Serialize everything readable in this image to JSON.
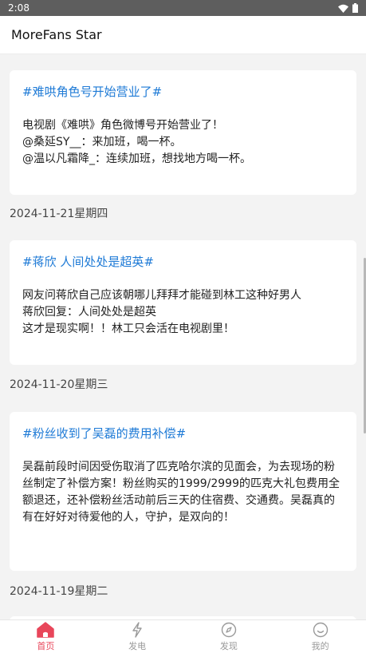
{
  "status_bar": {
    "time": "2:08",
    "icons": [
      "wifi-icon",
      "battery-icon"
    ]
  },
  "app_bar": {
    "title": "MoreFans Star"
  },
  "posts": [
    {
      "title": "#难哄角色号开始营业了#",
      "body": "电视剧《难哄》角色微博号开始营业了！\n@桑延SY__：来加班，喝一杯。\n@温以凡霜降_：连续加班，想找地方喝一杯。",
      "date": "2024-11-21星期四"
    },
    {
      "title": "#蒋欣 人间处处是超英#",
      "body": "网友问蒋欣自己应该朝哪儿拜拜才能碰到林工这种好男人\n蒋欣回复：人间处处是超英\n这才是现实啊！！林工只会活在电视剧里！",
      "date": "2024-11-20星期三"
    },
    {
      "title": "#粉丝收到了吴磊的费用补偿#",
      "body": "吴磊前段时间因受伤取消了匹克哈尔滨的见面会，为去现场的粉丝制定了补偿方案！粉丝购买的1999/2999的匹克大礼包费用全额退还，还补偿粉丝活动前后三天的住宿费、交通费。吴磊真的有在好好对待爱他的人，守护，是双向的！",
      "date": "2024-11-19星期二"
    }
  ],
  "tabs": [
    {
      "label": "首页",
      "icon": "home-icon",
      "active": true
    },
    {
      "label": "发电",
      "icon": "lightning-icon",
      "active": false
    },
    {
      "label": "发现",
      "icon": "compass-icon",
      "active": false
    },
    {
      "label": "我的",
      "icon": "smile-icon",
      "active": false
    }
  ],
  "colors": {
    "accent": "#e8465a",
    "link": "#1e7ad6",
    "inactive": "#9a9a9a"
  }
}
